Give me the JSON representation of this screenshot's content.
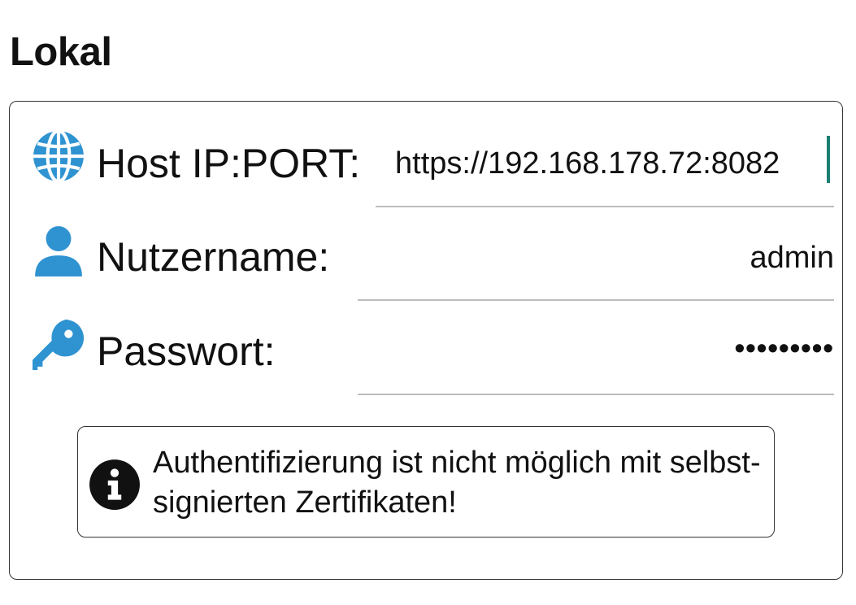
{
  "section": {
    "title": "Lokal"
  },
  "form": {
    "host": {
      "icon": "globe-icon",
      "label": "Host IP:PORT:",
      "value": "https://192.168.178.72:8082"
    },
    "username": {
      "icon": "user-icon",
      "label": "Nutzername:",
      "value": "admin"
    },
    "password": {
      "icon": "key-icon",
      "label": "Passwort:",
      "value": "•••••••••"
    }
  },
  "info": {
    "icon": "info-icon",
    "text": "Authentifizierung ist nicht möglich mit selbst-signierten Zertifikaten!"
  },
  "colors": {
    "icon_blue": "#2f93d1",
    "cursor_teal": "#1b7f72",
    "underline": "#bdbdbd",
    "border": "#333333"
  }
}
